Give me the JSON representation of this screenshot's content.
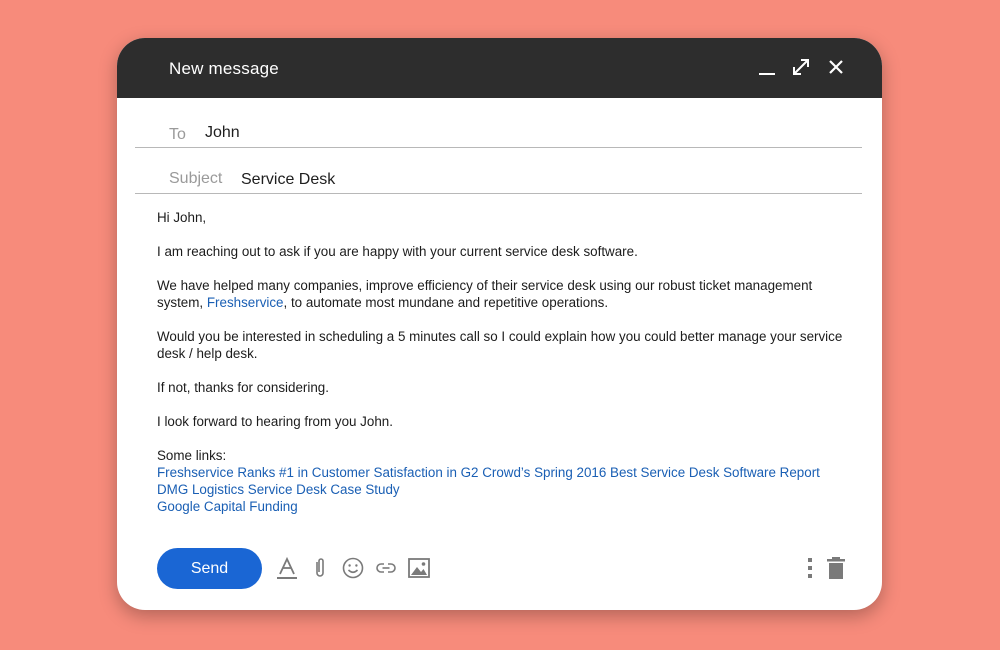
{
  "window": {
    "title": "New message"
  },
  "fields": {
    "to": {
      "label": "To",
      "value": "John"
    },
    "subject": {
      "label": "Subject",
      "value": "Service Desk"
    }
  },
  "body": {
    "greeting": "Hi John,",
    "p1": "I am reaching out to ask if you are happy with your current service desk software.",
    "p2_before": "We have helped many companies, improve efficiency of their service desk using our robust ticket management system, ",
    "p2_link": "Freshservice",
    "p2_after": ", to automate most mundane and repetitive operations.",
    "p3": "Would you be interested in scheduling a 5 minutes call so I could explain how you could better manage your service desk / help desk.",
    "p4": "If not, thanks for considering.",
    "p5": "I look forward to hearing from you John.",
    "links_heading": "Some links:",
    "links": [
      "Freshservice Ranks #1 in Customer Satisfaction in G2 Crowd’s Spring 2016 Best Service Desk Software Report",
      "DMG Logistics Service Desk Case Study",
      "Google Capital Funding"
    ]
  },
  "toolbar": {
    "send_label": "Send",
    "icons": [
      "minimize-icon",
      "expand-icon",
      "close-icon",
      "text-format-icon",
      "paperclip-icon",
      "emoji-icon",
      "link-icon",
      "image-icon",
      "more-vertical-icon",
      "trash-icon"
    ]
  },
  "colors": {
    "background": "#f78b7b",
    "titlebar": "#2d2d2d",
    "accent": "#1a66d4",
    "link": "#1a5fb4"
  }
}
